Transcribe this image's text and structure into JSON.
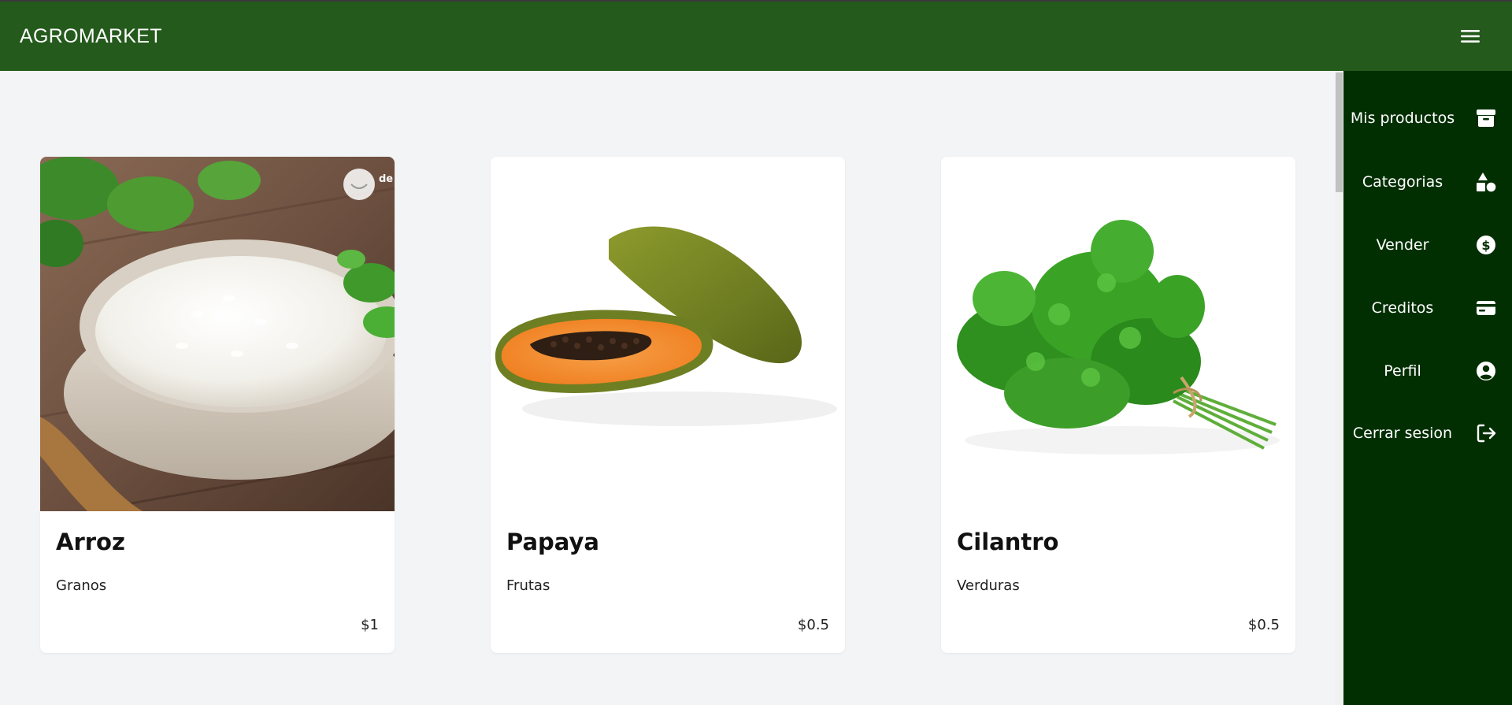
{
  "navbar": {
    "brand": "AGROMARKET",
    "menu_icon": "hamburger-menu-icon"
  },
  "products": [
    {
      "name": "Arroz",
      "category": "Granos",
      "price": "$1",
      "image": "rice-bowl-image",
      "watermark": "de Re"
    },
    {
      "name": "Papaya",
      "category": "Frutas",
      "price": "$0.5",
      "image": "papaya-image"
    },
    {
      "name": "Cilantro",
      "category": "Verduras",
      "price": "$0.5",
      "image": "cilantro-bunch-image"
    }
  ],
  "sidebar": {
    "items": [
      {
        "label": "Mis productos",
        "icon": "archive-box-icon"
      },
      {
        "label": "Categorias",
        "icon": "shapes-icon"
      },
      {
        "label": "Vender",
        "icon": "dollar-circle-icon"
      },
      {
        "label": "Creditos",
        "icon": "credit-card-icon"
      },
      {
        "label": "Perfil",
        "icon": "user-circle-icon"
      },
      {
        "label": "Cerrar sesion",
        "icon": "logout-icon"
      }
    ]
  },
  "colors": {
    "navbar": "#245a1c",
    "sidebar": "#022f02",
    "background": "#f3f4f6",
    "card": "#ffffff"
  }
}
